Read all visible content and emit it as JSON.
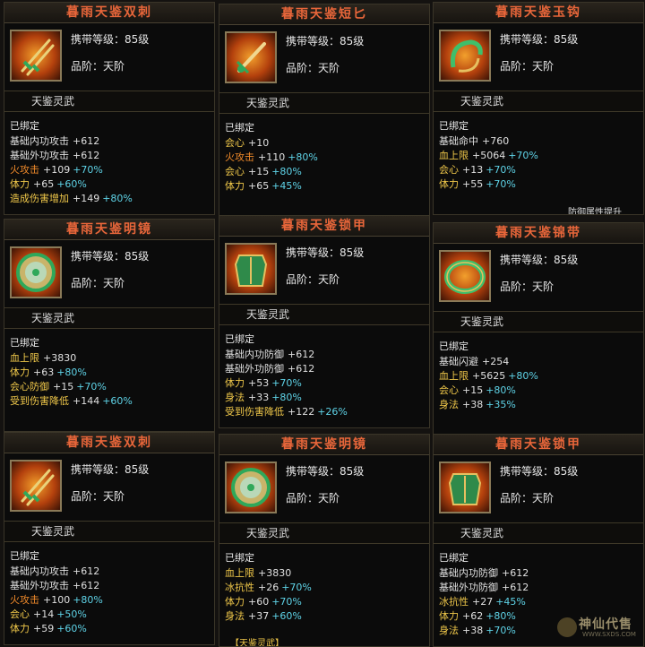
{
  "cards": [
    {
      "title": "暮雨天鉴双刺",
      "level_line": "携带等级：85级",
      "rank_line": "品阶：天阶",
      "category": "天鉴灵武",
      "bound": "已绑定",
      "icon": "twin-dagger-icon",
      "stats": [
        {
          "label": "基础内功攻击",
          "value": "+612",
          "bonus": "",
          "color": "white"
        },
        {
          "label": "基础外功攻击",
          "value": "+612",
          "bonus": "",
          "color": "white"
        },
        {
          "label": "火攻击",
          "value": "+109",
          "bonus": "+70%",
          "color": "orange"
        },
        {
          "label": "体力",
          "value": "+65",
          "bonus": "+60%",
          "color": "yellow"
        },
        {
          "label": "造成伤害增加",
          "value": "+149",
          "bonus": "+80%",
          "color": "yellow"
        }
      ]
    },
    {
      "title": "暮雨天鉴短匕",
      "level_line": "携带等级：85级",
      "rank_line": "品阶：天阶",
      "category": "天鉴灵武",
      "bound": "已绑定",
      "icon": "short-dagger-icon",
      "stats": [
        {
          "label": "会心",
          "value": "+10",
          "bonus": "",
          "color": "yellow"
        },
        {
          "label": "火攻击",
          "value": "+110",
          "bonus": "+80%",
          "color": "orange"
        },
        {
          "label": "会心",
          "value": "+15",
          "bonus": "+80%",
          "color": "yellow"
        },
        {
          "label": "体力",
          "value": "+65",
          "bonus": "+45%",
          "color": "yellow"
        }
      ]
    },
    {
      "title": "暮雨天鉴玉钩",
      "level_line": "携带等级：85级",
      "rank_line": "品阶：天阶",
      "category": "天鉴灵武",
      "bound": "已绑定",
      "icon": "jade-hook-icon",
      "stats": [
        {
          "label": "基础命中",
          "value": "+760",
          "bonus": "",
          "color": "white"
        },
        {
          "label": "血上限",
          "value": "+5064",
          "bonus": "+70%",
          "color": "yellow"
        },
        {
          "label": "会心",
          "value": "+13",
          "bonus": "+70%",
          "color": "yellow"
        },
        {
          "label": "体力",
          "value": "+55",
          "bonus": "+70%",
          "color": "yellow"
        }
      ],
      "clipped": "防御属性提升"
    },
    {
      "title": "暮雨天鉴明镜",
      "level_line": "携带等级：85级",
      "rank_line": "品阶：天阶",
      "category": "天鉴灵武",
      "bound": "已绑定",
      "icon": "mirror-icon",
      "stats": [
        {
          "label": "血上限",
          "value": "+3830",
          "bonus": "",
          "color": "yellow"
        },
        {
          "label": "体力",
          "value": "+63",
          "bonus": "+80%",
          "color": "yellow"
        },
        {
          "label": "会心防御",
          "value": "+15",
          "bonus": "+70%",
          "color": "yellow"
        },
        {
          "label": "受到伤害降低",
          "value": "+144",
          "bonus": "+60%",
          "color": "yellow"
        }
      ]
    },
    {
      "title": "暮雨天鉴锁甲",
      "level_line": "携带等级：85级",
      "rank_line": "品阶：天阶",
      "category": "天鉴灵武",
      "bound": "已绑定",
      "icon": "armor-icon",
      "stats": [
        {
          "label": "基础内功防御",
          "value": "+612",
          "bonus": "",
          "color": "white"
        },
        {
          "label": "基础外功防御",
          "value": "+612",
          "bonus": "",
          "color": "white"
        },
        {
          "label": "体力",
          "value": "+53",
          "bonus": "+70%",
          "color": "yellow"
        },
        {
          "label": "身法",
          "value": "+33",
          "bonus": "+80%",
          "color": "yellow"
        },
        {
          "label": "受到伤害降低",
          "value": "+122",
          "bonus": "+26%",
          "color": "yellow"
        }
      ]
    },
    {
      "title": "暮雨天鉴锦带",
      "level_line": "携带等级：85级",
      "rank_line": "品阶：天阶",
      "category": "天鉴灵武",
      "bound": "已绑定",
      "icon": "belt-icon",
      "stats": [
        {
          "label": "基础闪避",
          "value": "+254",
          "bonus": "",
          "color": "white"
        },
        {
          "label": "血上限",
          "value": "+5625",
          "bonus": "+80%",
          "color": "yellow"
        },
        {
          "label": "会心",
          "value": "+15",
          "bonus": "+80%",
          "color": "yellow"
        },
        {
          "label": "身法",
          "value": "+38",
          "bonus": "+35%",
          "color": "yellow"
        }
      ]
    },
    {
      "title": "暮雨天鉴双刺",
      "level_line": "携带等级：85级",
      "rank_line": "品阶：天阶",
      "category": "天鉴灵武",
      "bound": "已绑定",
      "icon": "twin-dagger-icon",
      "stats": [
        {
          "label": "基础内功攻击",
          "value": "+612",
          "bonus": "",
          "color": "white"
        },
        {
          "label": "基础外功攻击",
          "value": "+612",
          "bonus": "",
          "color": "white"
        },
        {
          "label": "火攻击",
          "value": "+100",
          "bonus": "+80%",
          "color": "orange"
        },
        {
          "label": "会心",
          "value": "+14",
          "bonus": "+50%",
          "color": "yellow"
        },
        {
          "label": "体力",
          "value": "+59",
          "bonus": "+60%",
          "color": "yellow"
        }
      ]
    },
    {
      "title": "暮雨天鉴明镜",
      "level_line": "携带等级：85级",
      "rank_line": "品阶：天阶",
      "category": "天鉴灵武",
      "bound": "已绑定",
      "icon": "mirror-icon",
      "stats": [
        {
          "label": "血上限",
          "value": "+3830",
          "bonus": "",
          "color": "yellow"
        },
        {
          "label": "冰抗性",
          "value": "+26",
          "bonus": "+70%",
          "color": "yellow"
        },
        {
          "label": "体力",
          "value": "+60",
          "bonus": "+70%",
          "color": "yellow"
        },
        {
          "label": "身法",
          "value": "+37",
          "bonus": "+60%",
          "color": "yellow"
        }
      ],
      "clipped": "【天鉴灵武】"
    },
    {
      "title": "暮雨天鉴锁甲",
      "level_line": "携带等级：85级",
      "rank_line": "品阶：天阶",
      "category": "天鉴灵武",
      "bound": "已绑定",
      "icon": "armor-icon",
      "stats": [
        {
          "label": "基础内功防御",
          "value": "+612",
          "bonus": "",
          "color": "white"
        },
        {
          "label": "基础外功防御",
          "value": "+612",
          "bonus": "",
          "color": "white"
        },
        {
          "label": "冰抗性",
          "value": "+27",
          "bonus": "+45%",
          "color": "yellow"
        },
        {
          "label": "体力",
          "value": "+62",
          "bonus": "+80%",
          "color": "yellow"
        },
        {
          "label": "身法",
          "value": "+38",
          "bonus": "+70%",
          "color": "yellow"
        }
      ]
    }
  ],
  "watermark": {
    "text": "神仙代售",
    "url": "WWW.SXDS.COM"
  },
  "colors": {
    "title": "#e8663a",
    "bonus": "#5fd4e8",
    "yellow": "#f0c84a",
    "orange": "#f08a2a"
  }
}
